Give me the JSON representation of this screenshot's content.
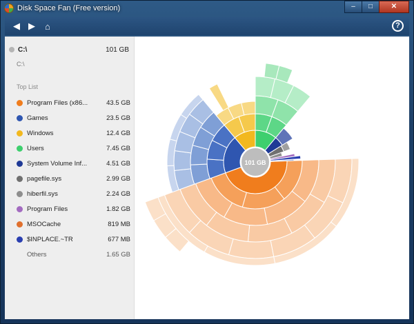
{
  "window": {
    "title": "Disk Space Fan (Free version)",
    "min_icon": "–",
    "max_icon": "□",
    "close_icon": "✕"
  },
  "toolbar": {
    "back_icon": "◀",
    "forward_icon": "▶",
    "home_icon": "⌂",
    "help_icon": "?"
  },
  "drive": {
    "name": "C:\\",
    "size": "101 GB",
    "path": "C:\\"
  },
  "sidebar": {
    "section_title": "Top List",
    "items": [
      {
        "name": "Program Files (x86...",
        "size": "43.5 GB",
        "color": "#f07d1d"
      },
      {
        "name": "Games",
        "size": "23.5 GB",
        "color": "#2f56b0"
      },
      {
        "name": "Windows",
        "size": "12.4 GB",
        "color": "#f2b81e"
      },
      {
        "name": "Users",
        "size": "7.45 GB",
        "color": "#3ecf6e"
      },
      {
        "name": "System Volume Inf...",
        "size": "4.51 GB",
        "color": "#1f3a96"
      },
      {
        "name": "pagefile.sys",
        "size": "2.99 GB",
        "color": "#707070"
      },
      {
        "name": "hiberfil.sys",
        "size": "2.24 GB",
        "color": "#8e8e8e"
      },
      {
        "name": "Program Files",
        "size": "1.82 GB",
        "color": "#a36bc0"
      },
      {
        "name": "MSOCache",
        "size": "819 MB",
        "color": "#e0702e"
      },
      {
        "name": "$INPLACE.~TR",
        "size": "677 MB",
        "color": "#2a3fb0"
      }
    ],
    "others": {
      "name": "Others",
      "size": "1.65 GB"
    }
  },
  "chart": {
    "center_label": "101 GB"
  }
}
